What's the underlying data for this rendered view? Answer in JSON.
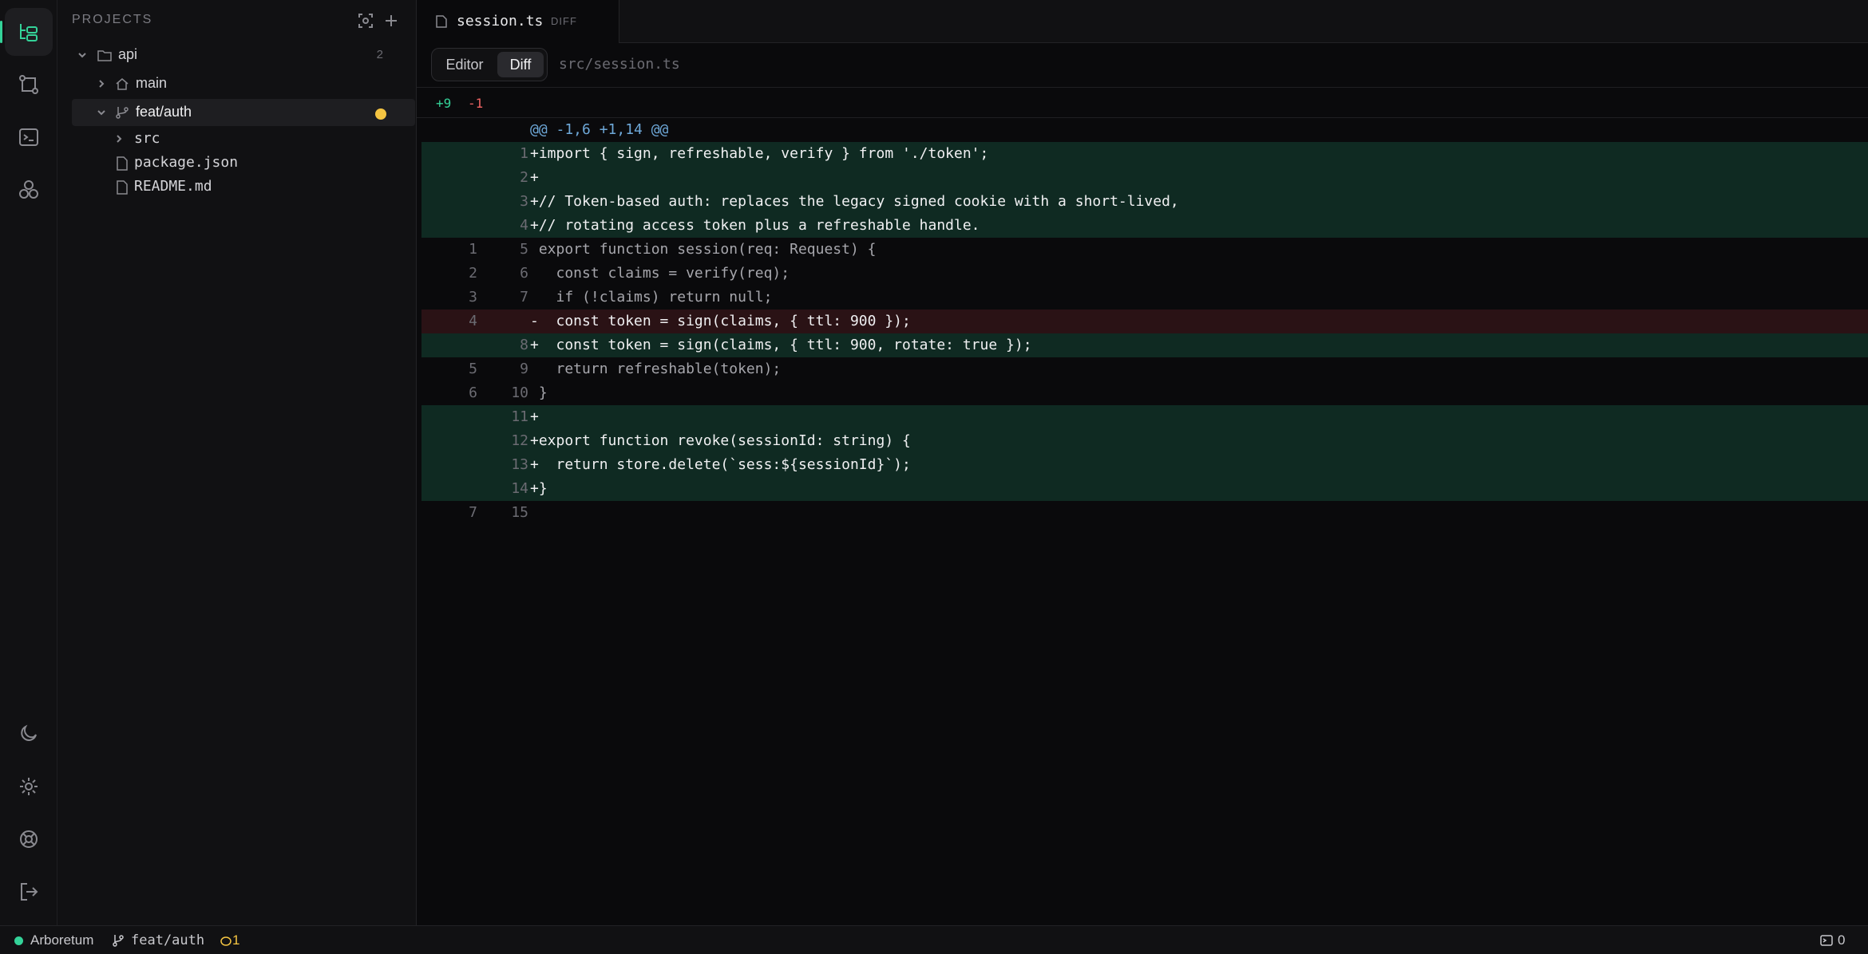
{
  "sidebar": {
    "title": "PROJECTS",
    "project": {
      "name": "api",
      "count": "2"
    },
    "items": [
      {
        "label": "main"
      },
      {
        "label": "feat/auth"
      },
      {
        "label": "src"
      },
      {
        "label": "package.json"
      },
      {
        "label": "README.md"
      }
    ]
  },
  "tab": {
    "name": "session.ts",
    "badge": "DIFF"
  },
  "toolbar": {
    "editor": "Editor",
    "diff": "Diff",
    "path": "src/session.ts"
  },
  "stats": {
    "added": "+9",
    "removed": "-1"
  },
  "diff": {
    "lines": [
      {
        "type": "hunk",
        "old": "",
        "new": "",
        "text": "@@ -1,6 +1,14 @@"
      },
      {
        "type": "add",
        "old": "",
        "new": "1",
        "text": "+import { sign, refreshable, verify } from './token';"
      },
      {
        "type": "add",
        "old": "",
        "new": "2",
        "text": "+"
      },
      {
        "type": "add",
        "old": "",
        "new": "3",
        "text": "+// Token-based auth: replaces the legacy signed cookie with a short-lived,"
      },
      {
        "type": "add",
        "old": "",
        "new": "4",
        "text": "+// rotating access token plus a refreshable handle."
      },
      {
        "type": "ctx",
        "old": "1",
        "new": "5",
        "text": " export function session(req: Request) {"
      },
      {
        "type": "ctx",
        "old": "2",
        "new": "6",
        "text": "   const claims = verify(req);"
      },
      {
        "type": "ctx",
        "old": "3",
        "new": "7",
        "text": "   if (!claims) return null;"
      },
      {
        "type": "del",
        "old": "4",
        "new": "",
        "text": "-  const token = sign(claims, { ttl: 900 });"
      },
      {
        "type": "add",
        "old": "",
        "new": "8",
        "text": "+  const token = sign(claims, { ttl: 900, rotate: true });"
      },
      {
        "type": "ctx",
        "old": "5",
        "new": "9",
        "text": "   return refreshable(token);"
      },
      {
        "type": "ctx",
        "old": "6",
        "new": "10",
        "text": " }"
      },
      {
        "type": "add",
        "old": "",
        "new": "11",
        "text": "+"
      },
      {
        "type": "add",
        "old": "",
        "new": "12",
        "text": "+export function revoke(sessionId: string) {"
      },
      {
        "type": "add",
        "old": "",
        "new": "13",
        "text": "+  return store.delete(`sess:${sessionId}`);"
      },
      {
        "type": "add",
        "old": "",
        "new": "14",
        "text": "+}"
      },
      {
        "type": "ctx",
        "old": "7",
        "new": "15",
        "text": ""
      }
    ]
  },
  "status": {
    "app": "Arboretum",
    "branch": "feat/auth",
    "changes": "1",
    "problems": "0"
  }
}
